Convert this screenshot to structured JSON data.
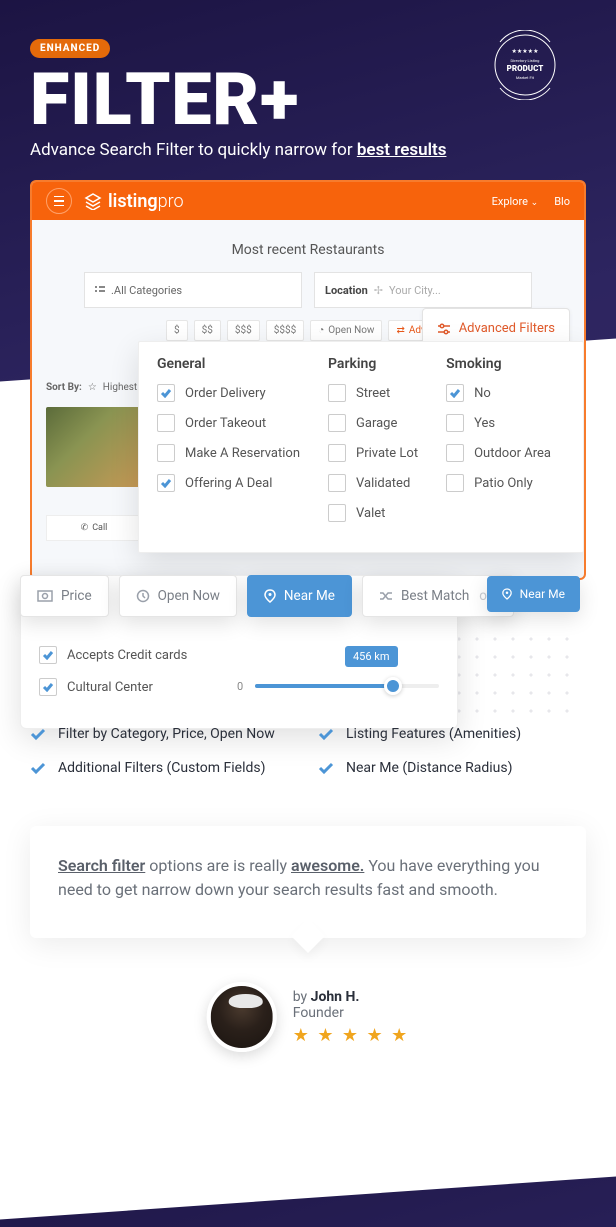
{
  "hero": {
    "pill": "ENHANCED",
    "title": "FILTER+",
    "sub_pre": "Advance Search Filter to quickly narrow for ",
    "sub_u": "best results"
  },
  "seal": {
    "top": "Directory Listing",
    "mid": "PRODUCT",
    "bot": "Market Fit"
  },
  "topbar": {
    "logo_a": "listing",
    "logo_b": "pro",
    "explore": "Explore",
    "blog": "Blo"
  },
  "app": {
    "mr_title": "Most recent Restaurants",
    "cat_placeholder": ".All Categories",
    "loc_label": "Location",
    "loc_placeholder": "Your City...",
    "price_pills": [
      "$",
      "$$",
      "$$$",
      "$$$$"
    ],
    "open_now": "Open Now",
    "adv_short": "Advanc",
    "adv_filters": "Advanced Filters",
    "sort_by": "Sort By:",
    "highest": "Highest Rate",
    "call": "Call"
  },
  "filters": {
    "cols": [
      {
        "title": "General",
        "items": [
          {
            "label": "Order Delivery",
            "on": true
          },
          {
            "label": "Order Takeout",
            "on": false
          },
          {
            "label": "Make A Reservation",
            "on": false
          },
          {
            "label": "Offering A Deal",
            "on": true
          }
        ]
      },
      {
        "title": "Parking",
        "items": [
          {
            "label": "Street",
            "on": false
          },
          {
            "label": "Garage",
            "on": false
          },
          {
            "label": "Private Lot",
            "on": false
          },
          {
            "label": "Validated",
            "on": false
          },
          {
            "label": "Valet",
            "on": false
          }
        ]
      },
      {
        "title": "Smoking",
        "items": [
          {
            "label": "No",
            "on": true
          },
          {
            "label": "Yes",
            "on": false
          },
          {
            "label": "Outdoor Area",
            "on": false
          },
          {
            "label": "Patio Only",
            "on": false
          }
        ]
      }
    ]
  },
  "float": {
    "price": "Price",
    "open_now": "Open Now",
    "near_me": "Near Me",
    "best_match": "Best Match"
  },
  "slider": {
    "cc": "Accepts Credit cards",
    "cult": "Cultural Center",
    "zero": "0",
    "tag": "456 km"
  },
  "features": [
    "Filter by Category, Price, Open Now",
    "Listing Features (Amenities)",
    "Additional Filters (Custom Fields)",
    "Near Me (Distance Radius)"
  ],
  "quote": {
    "p1a": "Search filter",
    "p1b": " options are is really ",
    "p1c": "awesome.",
    "p2": " You have everything you need to get narrow down your search results fast and smooth."
  },
  "author": {
    "by": "by ",
    "name": "John H.",
    "role": "Founder",
    "stars": "★ ★ ★ ★ ★"
  }
}
